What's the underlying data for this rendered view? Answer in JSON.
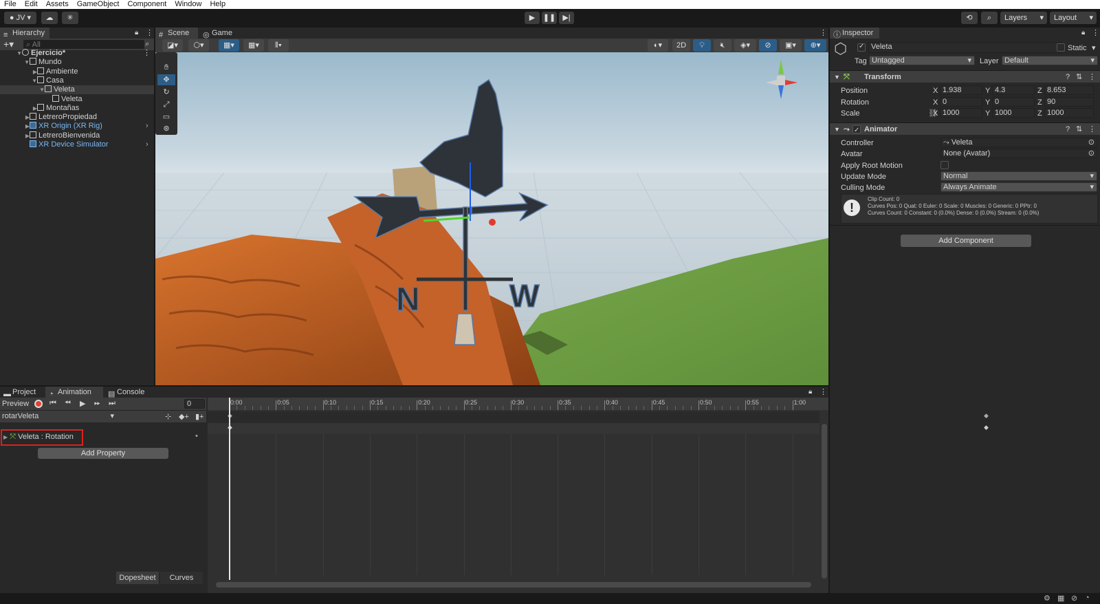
{
  "menu": [
    "File",
    "Edit",
    "Assets",
    "GameObject",
    "Component",
    "Window",
    "Help"
  ],
  "toolbar": {
    "account": "JV",
    "layers": "Layers",
    "layout": "Layout"
  },
  "hierarchy": {
    "tab": "Hierarchy",
    "search_placeholder": "All",
    "items": [
      {
        "label": "Ejercicio*",
        "indent": 0,
        "arrow": "▼",
        "blue": false,
        "icon": "unity-scene-icon"
      },
      {
        "label": "Mundo",
        "indent": 1,
        "arrow": "▼",
        "blue": false
      },
      {
        "label": "Ambiente",
        "indent": 2,
        "arrow": "▶",
        "blue": false
      },
      {
        "label": "Casa",
        "indent": 2,
        "arrow": "▼",
        "blue": false
      },
      {
        "label": "Veleta",
        "indent": 3,
        "arrow": "▼",
        "blue": false,
        "selected": true
      },
      {
        "label": "Veleta",
        "indent": 4,
        "arrow": "",
        "blue": false
      },
      {
        "label": "Montañas",
        "indent": 2,
        "arrow": "▶",
        "blue": false
      },
      {
        "label": "LetreroPropiedad",
        "indent": 1,
        "arrow": "▶",
        "blue": false
      },
      {
        "label": "XR Origin (XR Rig)",
        "indent": 1,
        "arrow": "▶",
        "blue": true
      },
      {
        "label": "LetreroBienvenida",
        "indent": 1,
        "arrow": "▶",
        "blue": false
      },
      {
        "label": "XR Device Simulator",
        "indent": 1,
        "arrow": "",
        "blue": true
      }
    ]
  },
  "scene": {
    "tabs": [
      "Scene",
      "Game"
    ],
    "mode_2d": "2D"
  },
  "inspector": {
    "tab": "Inspector",
    "object_name": "Veleta",
    "static_label": "Static",
    "tag_label": "Tag",
    "tag_value": "Untagged",
    "layer_label": "Layer",
    "layer_value": "Default",
    "transform": {
      "title": "Transform",
      "position_label": "Position",
      "position": {
        "x": "1.938",
        "y": "4.3",
        "z": "8.653"
      },
      "rotation_label": "Rotation",
      "rotation": {
        "x": "0",
        "y": "0",
        "z": "90"
      },
      "scale_label": "Scale",
      "scale": {
        "x": "1000",
        "y": "1000",
        "z": "1000"
      }
    },
    "animator": {
      "title": "Animator",
      "controller_label": "Controller",
      "controller": "Veleta",
      "avatar_label": "Avatar",
      "avatar": "None (Avatar)",
      "root_motion_label": "Apply Root Motion",
      "update_label": "Update Mode",
      "update": "Normal",
      "culling_label": "Culling Mode",
      "culling": "Always Animate",
      "info1": "Clip Count: 0",
      "info2": "Curves Pos: 0 Quat: 0 Euler: 0 Scale: 0 Muscles: 0 Generic: 0 PPtr: 0",
      "info3": "Curves Count: 0 Constant: 0 (0.0%) Dense: 0 (0.0%) Stream: 0 (0.0%)"
    },
    "add_component": "Add Component"
  },
  "animation": {
    "tabs": [
      "Project",
      "Animation",
      "Console"
    ],
    "preview": "Preview",
    "frame": "0",
    "clip": "rotarVeleta",
    "property": "Veleta : Rotation",
    "add_property": "Add Property",
    "ruler": [
      "0:00",
      "0:05",
      "0:10",
      "0:15",
      "0:20",
      "0:25",
      "0:30",
      "0:35",
      "0:40",
      "0:45",
      "0:50",
      "0:55",
      "1:00"
    ],
    "dopesheet": "Dopesheet",
    "curves": "Curves"
  },
  "colors": {
    "accent": "#2c5d87",
    "highlight_box": "#e0201c",
    "selection": "#2c5d87"
  }
}
